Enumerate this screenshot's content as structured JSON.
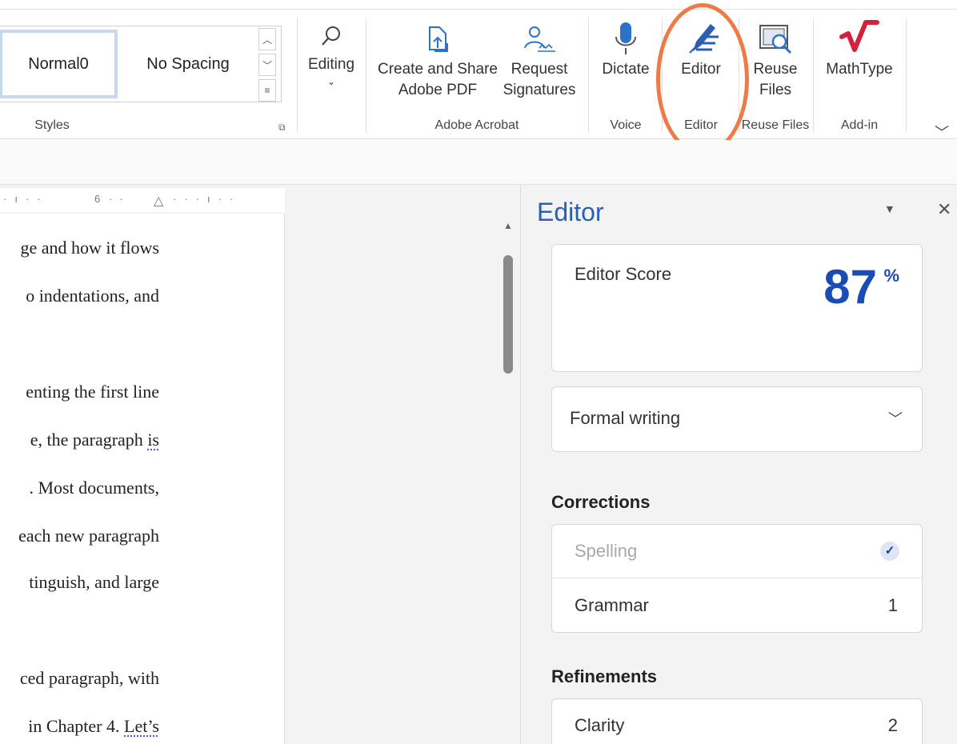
{
  "ribbon": {
    "styles": {
      "items": [
        "Normal0",
        "No Spacing"
      ],
      "group_label": "Styles"
    },
    "editing": {
      "label": "Editing"
    },
    "acrobat": {
      "create_share_line1": "Create and Share",
      "create_share_line2": "Adobe PDF",
      "request_line1": "Request",
      "request_line2": "Signatures",
      "group_label": "Adobe Acrobat"
    },
    "voice": {
      "dictate_label": "Dictate",
      "group_label": "Voice"
    },
    "editor": {
      "label": "Editor",
      "group_label": "Editor"
    },
    "reuse": {
      "line1": "Reuse",
      "line2": "Files",
      "group_label": "Reuse Files"
    },
    "addin": {
      "mathtype_label": "MathType",
      "group_label": "Add-in"
    },
    "accent_color": "#2b5fb3",
    "highlight_color": "#ee7a45"
  },
  "ruler": {
    "marker": "6"
  },
  "document": {
    "lines": [
      "ge and how it flows",
      "o  indentations,  and",
      "",
      "enting the first line",
      "e,  the  paragraph",
      ". Most documents,",
      "each new paragraph",
      "tinguish,  and  large",
      "",
      "ced paragraph, with",
      " in Chapter 4."
    ],
    "squiggle_words": [
      "is",
      "Let’s"
    ]
  },
  "editor_pane": {
    "title": "Editor",
    "score_label": "Editor Score",
    "score_value": "87",
    "score_unit": "%",
    "writing_style": "Formal writing",
    "corrections_heading": "Corrections",
    "corrections": [
      {
        "label": "Spelling",
        "count": "✓"
      },
      {
        "label": "Grammar",
        "count": "1"
      }
    ],
    "refinements_heading": "Refinements",
    "refinements": [
      {
        "label": "Clarity",
        "count": "2"
      }
    ]
  }
}
